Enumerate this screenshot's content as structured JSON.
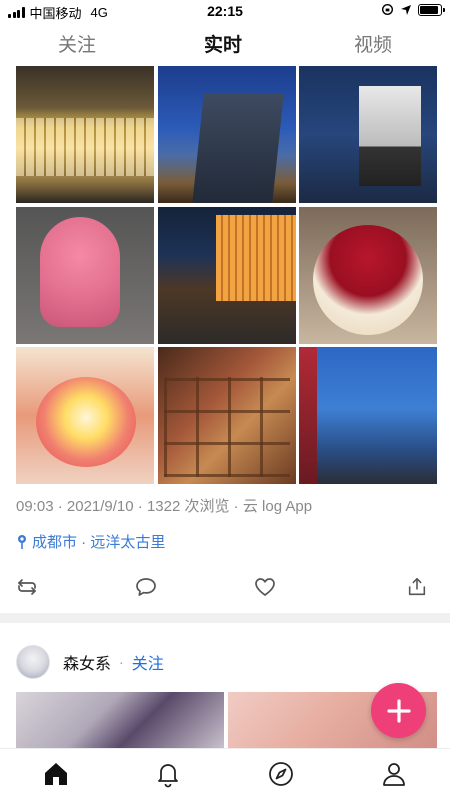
{
  "status_bar": {
    "carrier": "中国移动",
    "network": "4G",
    "time": "22:15",
    "battery_level": 0.9
  },
  "top_tabs": [
    {
      "label": "关注",
      "active": false
    },
    {
      "label": "实时",
      "active": true
    },
    {
      "label": "视频",
      "active": false
    }
  ],
  "post1": {
    "photos": [
      "shopping-mall-facade",
      "ifs-building-dusk",
      "ifs-building-night",
      "pink-figure-statue",
      "prada-storefront-night",
      "cherry-dessert-cup",
      "fruit-shaved-ice",
      "hotpot-platter",
      "city-skyline-terrace"
    ],
    "time": "09:03",
    "date": "2021/9/10",
    "views": "1322 次浏览",
    "source": "云 log App",
    "separator": " · ",
    "location": "成都市 · 远洋太古里"
  },
  "post2": {
    "username": "森女系",
    "separator": "·",
    "follow_label": "关注"
  },
  "icons": {
    "repost": "repost-icon",
    "comment": "comment-icon",
    "like": "heart-icon",
    "share": "share-icon",
    "location": "location-pin-icon",
    "fab": "plus-icon",
    "nav_home": "home-icon",
    "nav_notifications": "bell-icon",
    "nav_discover": "compass-icon",
    "nav_profile": "profile-icon"
  },
  "colors": {
    "accent_blue": "#1e6fe0",
    "location_blue": "#3b7bd6",
    "fab_pink": "#ee3f78",
    "meta_gray": "#8a8a8a"
  }
}
